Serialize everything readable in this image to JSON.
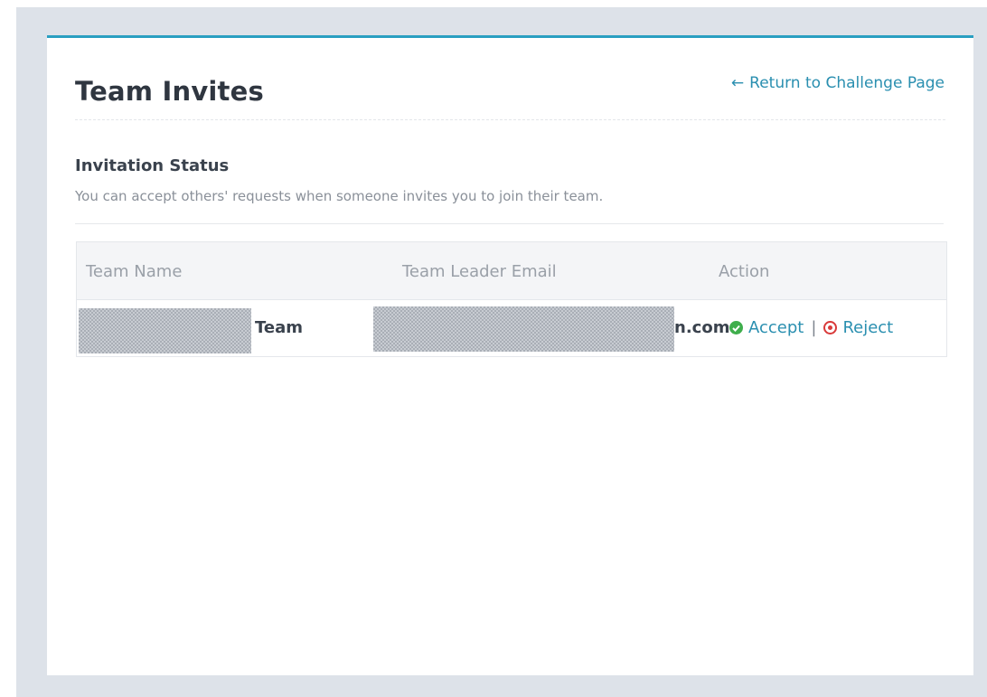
{
  "header": {
    "title": "Team Invites",
    "return_link": "Return to Challenge Page"
  },
  "section": {
    "title": "Invitation Status",
    "description": "You can accept others' requests when someone invites you to join their team."
  },
  "table": {
    "columns": [
      "Team Name",
      "Team Leader Email",
      "Action"
    ],
    "rows": [
      {
        "team_name_visible": "Team",
        "email_visible": "n.com",
        "accept_label": "Accept",
        "separator": "|",
        "reject_label": "Reject"
      }
    ]
  },
  "colors": {
    "accent": "#2a9fc1",
    "link": "#2a8fb0",
    "accept_icon": "#3fae4c",
    "reject_icon": "#d93a3a"
  },
  "icons": {
    "return": "arrow-left-icon",
    "accept": "check-circle-icon",
    "reject": "times-circle-icon"
  }
}
